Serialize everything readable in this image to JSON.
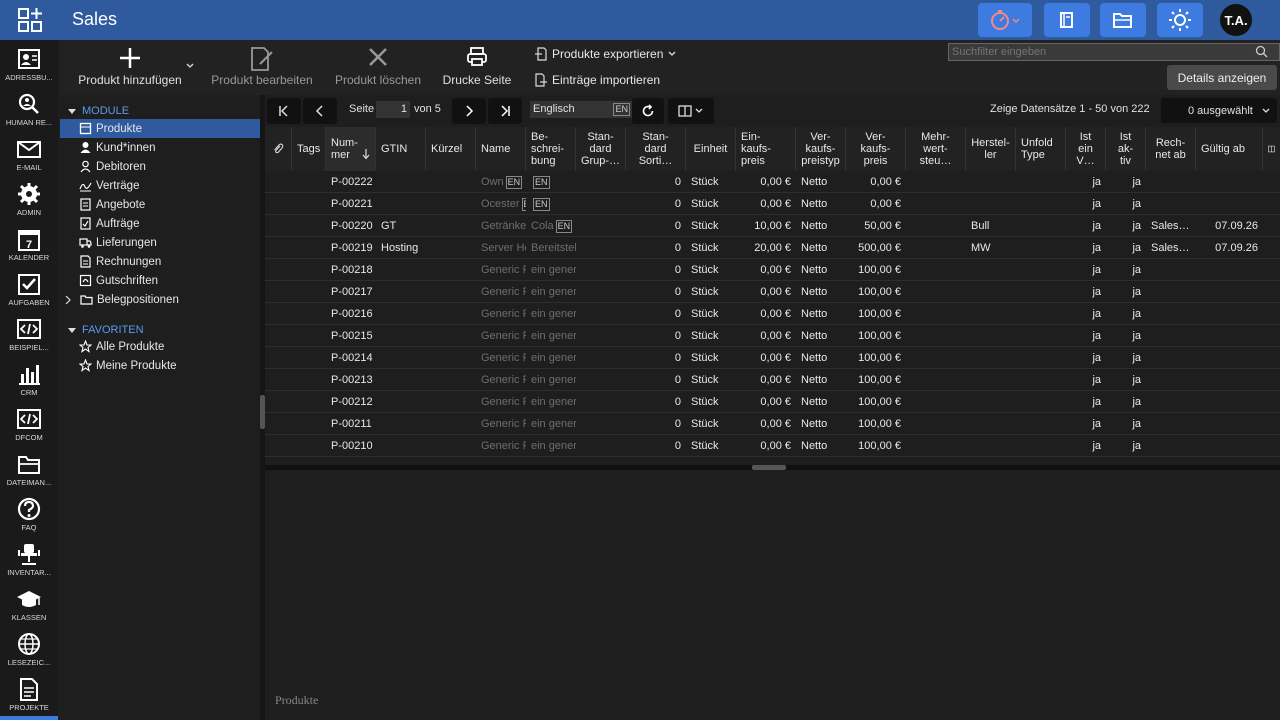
{
  "header": {
    "title": "Sales",
    "avatar_initials": "T.A."
  },
  "leftnav": [
    {
      "label": "ADRESSBU...",
      "icon": "address-book-icon"
    },
    {
      "label": "HUMAN RE...",
      "icon": "magnifier-user-icon"
    },
    {
      "label": "E-MAIL",
      "icon": "envelope-icon"
    },
    {
      "label": "ADMIN",
      "icon": "gear-icon"
    },
    {
      "label": "KALENDER",
      "icon": "calendar-icon"
    },
    {
      "label": "AUFGABEN",
      "icon": "checkbox-icon"
    },
    {
      "label": "BEISPIEL...",
      "icon": "code-icon"
    },
    {
      "label": "CRM",
      "icon": "bar-chart-icon"
    },
    {
      "label": "DFCOM",
      "icon": "code-icon"
    },
    {
      "label": "DATEIMAN...",
      "icon": "folder-icon"
    },
    {
      "label": "FAQ",
      "icon": "question-icon"
    },
    {
      "label": "INVENTAR...",
      "icon": "office-chair-icon"
    },
    {
      "label": "KLASSEN",
      "icon": "graduation-cap-icon"
    },
    {
      "label": "LESEZEIC...",
      "icon": "globe-icon"
    },
    {
      "label": "PROJEKTE",
      "icon": "document-icon"
    }
  ],
  "toolbar": {
    "add_label": "Produkt hinzufügen",
    "edit_label": "Produkt bearbeiten",
    "delete_label": "Produkt löschen",
    "print_label": "Drucke Seite",
    "export_label": "Produkte exportieren",
    "import_label": "Einträge importieren",
    "search_placeholder": "Suchfilter eingeben",
    "details_label": "Details anzeigen"
  },
  "tree": {
    "modules_label": "MODULE",
    "modules": [
      "Produkte",
      "Kund*innen",
      "Debitoren",
      "Verträge",
      "Angebote",
      "Aufträge",
      "Lieferungen",
      "Rechnungen",
      "Gutschriften",
      "Belegpositionen"
    ],
    "favorites_label": "FAVORITEN",
    "favorites": [
      "Alle Produkte",
      "Meine Produkte"
    ]
  },
  "pager": {
    "page_label": "Seite",
    "page_value": "1",
    "of_label": "von 5",
    "language": "Englisch",
    "lang_code": "EN",
    "records_text": "Zeige Datensätze 1 - 50 von 222",
    "selected_text": "0 ausgewählt"
  },
  "columns": [
    "Tags",
    "Num-\nmer",
    "GTIN",
    "Kürzel",
    "Name",
    "Be-\nschrei-\nbung",
    "Stan-\ndard\nGrup-…",
    "Stan-\ndard\nSorti…",
    "Einheit",
    "Ein-\nkaufs-\npreis",
    "Ver-\nkaufs-\npreistyp",
    "Ver-\nkaufs-\npreis",
    "Mehr-\nwert-\nsteu…",
    "Herstel-\nler",
    "Unfold\nType",
    "Ist\nein\nV…",
    "Ist\nak-\ntiv",
    "Rech-\nnet ab",
    "Gültig ab"
  ],
  "rows": [
    {
      "nummer": "P-00222",
      "gtin": "",
      "kuerzel": "",
      "name": "Own",
      "name_en": true,
      "beschr": "",
      "beschr_en": true,
      "sort": "0",
      "einheit": "Stück",
      "ek": "0,00 €",
      "vktyp": "Netto",
      "vk": "0,00 €",
      "herst": "",
      "istv": "ja",
      "aktiv": "ja",
      "rechnet": "",
      "gueltig": ""
    },
    {
      "nummer": "P-00221",
      "gtin": "",
      "kuerzel": "",
      "name": "Ocester",
      "name_en": true,
      "beschr": "",
      "beschr_en": true,
      "sort": "0",
      "einheit": "Stück",
      "ek": "0,00 €",
      "vktyp": "Netto",
      "vk": "0,00 €",
      "herst": "",
      "istv": "ja",
      "aktiv": "ja",
      "rechnet": "",
      "gueltig": ""
    },
    {
      "nummer": "P-00220",
      "gtin": "GT",
      "kuerzel": "",
      "name": "Getränke",
      "name_en": false,
      "beschr": "Cola",
      "beschr_en": true,
      "sort": "0",
      "einheit": "Stück",
      "ek": "10,00 €",
      "vktyp": "Netto",
      "vk": "50,00 €",
      "herst": "Bull",
      "istv": "ja",
      "aktiv": "ja",
      "rechnet": "Sales…",
      "gueltig": "07.09.26"
    },
    {
      "nummer": "P-00219",
      "gtin": "Hosting",
      "kuerzel": "",
      "name": "Server He",
      "name_en": false,
      "beschr": "Bereitstel",
      "beschr_en": false,
      "sort": "0",
      "einheit": "Stück",
      "ek": "20,00 €",
      "vktyp": "Netto",
      "vk": "500,00 €",
      "herst": "MW",
      "istv": "ja",
      "aktiv": "ja",
      "rechnet": "Sales…",
      "gueltig": "07.09.26"
    },
    {
      "nummer": "P-00218",
      "gtin": "",
      "kuerzel": "",
      "name": "Generic P",
      "name_en": false,
      "beschr": "ein gener",
      "beschr_en": false,
      "sort": "0",
      "einheit": "Stück",
      "ek": "0,00 €",
      "vktyp": "Netto",
      "vk": "100,00 €",
      "herst": "",
      "istv": "ja",
      "aktiv": "ja",
      "rechnet": "",
      "gueltig": ""
    },
    {
      "nummer": "P-00217",
      "gtin": "",
      "kuerzel": "",
      "name": "Generic P",
      "name_en": false,
      "beschr": "ein gener",
      "beschr_en": false,
      "sort": "0",
      "einheit": "Stück",
      "ek": "0,00 €",
      "vktyp": "Netto",
      "vk": "100,00 €",
      "herst": "",
      "istv": "ja",
      "aktiv": "ja",
      "rechnet": "",
      "gueltig": ""
    },
    {
      "nummer": "P-00216",
      "gtin": "",
      "kuerzel": "",
      "name": "Generic P",
      "name_en": false,
      "beschr": "ein gener",
      "beschr_en": false,
      "sort": "0",
      "einheit": "Stück",
      "ek": "0,00 €",
      "vktyp": "Netto",
      "vk": "100,00 €",
      "herst": "",
      "istv": "ja",
      "aktiv": "ja",
      "rechnet": "",
      "gueltig": ""
    },
    {
      "nummer": "P-00215",
      "gtin": "",
      "kuerzel": "",
      "name": "Generic P",
      "name_en": false,
      "beschr": "ein gener",
      "beschr_en": false,
      "sort": "0",
      "einheit": "Stück",
      "ek": "0,00 €",
      "vktyp": "Netto",
      "vk": "100,00 €",
      "herst": "",
      "istv": "ja",
      "aktiv": "ja",
      "rechnet": "",
      "gueltig": ""
    },
    {
      "nummer": "P-00214",
      "gtin": "",
      "kuerzel": "",
      "name": "Generic P",
      "name_en": false,
      "beschr": "ein gener",
      "beschr_en": false,
      "sort": "0",
      "einheit": "Stück",
      "ek": "0,00 €",
      "vktyp": "Netto",
      "vk": "100,00 €",
      "herst": "",
      "istv": "ja",
      "aktiv": "ja",
      "rechnet": "",
      "gueltig": ""
    },
    {
      "nummer": "P-00213",
      "gtin": "",
      "kuerzel": "",
      "name": "Generic P",
      "name_en": false,
      "beschr": "ein gener",
      "beschr_en": false,
      "sort": "0",
      "einheit": "Stück",
      "ek": "0,00 €",
      "vktyp": "Netto",
      "vk": "100,00 €",
      "herst": "",
      "istv": "ja",
      "aktiv": "ja",
      "rechnet": "",
      "gueltig": ""
    },
    {
      "nummer": "P-00212",
      "gtin": "",
      "kuerzel": "",
      "name": "Generic P",
      "name_en": false,
      "beschr": "ein gener",
      "beschr_en": false,
      "sort": "0",
      "einheit": "Stück",
      "ek": "0,00 €",
      "vktyp": "Netto",
      "vk": "100,00 €",
      "herst": "",
      "istv": "ja",
      "aktiv": "ja",
      "rechnet": "",
      "gueltig": ""
    },
    {
      "nummer": "P-00211",
      "gtin": "",
      "kuerzel": "",
      "name": "Generic P",
      "name_en": false,
      "beschr": "ein gener",
      "beschr_en": false,
      "sort": "0",
      "einheit": "Stück",
      "ek": "0,00 €",
      "vktyp": "Netto",
      "vk": "100,00 €",
      "herst": "",
      "istv": "ja",
      "aktiv": "ja",
      "rechnet": "",
      "gueltig": ""
    },
    {
      "nummer": "P-00210",
      "gtin": "",
      "kuerzel": "",
      "name": "Generic P",
      "name_en": false,
      "beschr": "ein gener",
      "beschr_en": false,
      "sort": "0",
      "einheit": "Stück",
      "ek": "0,00 €",
      "vktyp": "Netto",
      "vk": "100,00 €",
      "herst": "",
      "istv": "ja",
      "aktiv": "ja",
      "rechnet": "",
      "gueltig": ""
    }
  ],
  "bottom_label": "Produkte",
  "colors": {
    "header": "#2f5a9e",
    "header_button": "#3d7be0",
    "accent": "#5b9bf0",
    "selected": "#2f5a9e"
  }
}
